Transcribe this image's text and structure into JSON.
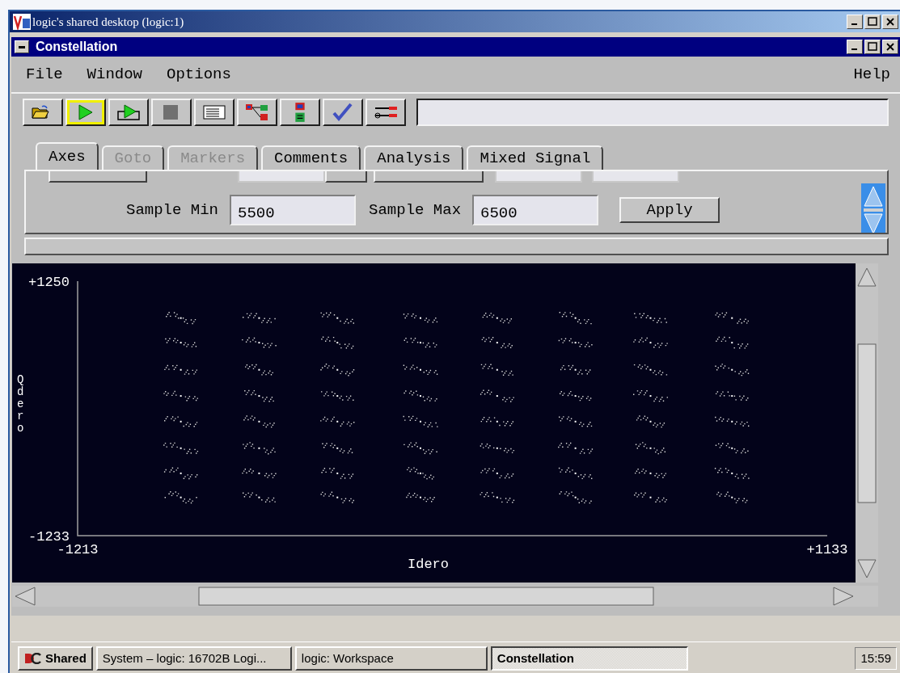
{
  "desktop_window": {
    "title": "logic's shared desktop (logic:1)"
  },
  "window": {
    "title": "Constellation"
  },
  "menu": {
    "left": [
      "File",
      "Window",
      "Options"
    ],
    "right": "Help"
  },
  "toolbar": [
    {
      "kind": "open",
      "highlighted": false
    },
    {
      "kind": "run",
      "highlighted": true
    },
    {
      "kind": "repeat",
      "highlighted": false
    },
    {
      "kind": "stop",
      "highlighted": false
    },
    {
      "kind": "listing",
      "highlighted": false
    },
    {
      "kind": "tree",
      "highlighted": false
    },
    {
      "kind": "stack",
      "highlighted": false
    },
    {
      "kind": "check",
      "highlighted": false
    },
    {
      "kind": "tools",
      "highlighted": false
    }
  ],
  "tabs": [
    {
      "label": "Axes",
      "selected": true,
      "disabled": false
    },
    {
      "label": "Goto",
      "selected": false,
      "disabled": true
    },
    {
      "label": "Markers",
      "selected": false,
      "disabled": true
    },
    {
      "label": "Comments",
      "selected": false,
      "disabled": false
    },
    {
      "label": "Analysis",
      "selected": false,
      "disabled": false
    },
    {
      "label": "Mixed Signal",
      "selected": false,
      "disabled": false
    }
  ],
  "axes_panel": {
    "sample_min_label": "Sample Min",
    "sample_min": "5500",
    "sample_max_label": "Sample Max",
    "sample_max": "6500",
    "apply": "Apply"
  },
  "plot": {
    "chart_data": {
      "type": "scatter",
      "xlabel": "Idero",
      "ylabel": "Qdero",
      "xlim": [
        -1213,
        1133
      ],
      "ylim": [
        -1233,
        1250
      ],
      "xticks": [
        {
          "value": -1213,
          "label": "-1213"
        },
        {
          "value": 1133,
          "label": "+1133"
        }
      ],
      "yticks": [
        {
          "value": -1233,
          "label": "-1233"
        },
        {
          "value": 1250,
          "label": "+1250"
        }
      ],
      "x": [
        -890,
        -645,
        -400,
        -140,
        100,
        345,
        580,
        835,
        -890,
        -645,
        -400,
        -140,
        100,
        345,
        580,
        835,
        -890,
        -645,
        -400,
        -140,
        100,
        345,
        580,
        835,
        -890,
        -645,
        -400,
        -140,
        100,
        345,
        580,
        835,
        -890,
        -645,
        -400,
        -140,
        100,
        345,
        580,
        835,
        -890,
        -645,
        -400,
        -140,
        100,
        345,
        580,
        835,
        -890,
        -645,
        -400,
        -140,
        100,
        345,
        580,
        835,
        -890,
        -645,
        -400,
        -140,
        100,
        345,
        580,
        835
      ],
      "series": [
        {
          "color": "#ffffff",
          "values": [
            890,
            890,
            890,
            890,
            890,
            890,
            890,
            890,
            650,
            650,
            650,
            650,
            650,
            650,
            650,
            650,
            385,
            385,
            385,
            385,
            385,
            385,
            385,
            385,
            130,
            130,
            130,
            130,
            130,
            130,
            130,
            130,
            -120,
            -120,
            -120,
            -120,
            -120,
            -120,
            -120,
            -120,
            -380,
            -380,
            -380,
            -380,
            -380,
            -380,
            -380,
            -380,
            -625,
            -625,
            -625,
            -625,
            -625,
            -625,
            -625,
            -625,
            -860,
            -860,
            -860,
            -860,
            -860,
            -860,
            -860,
            -860
          ]
        }
      ]
    }
  },
  "taskbar": {
    "start": "Shared",
    "items": [
      {
        "label": "System – logic: 16702B Logi...",
        "selected": false
      },
      {
        "label": "logic: Workspace",
        "selected": false
      },
      {
        "label": "Constellation",
        "selected": true
      }
    ],
    "clock": "15:59"
  }
}
